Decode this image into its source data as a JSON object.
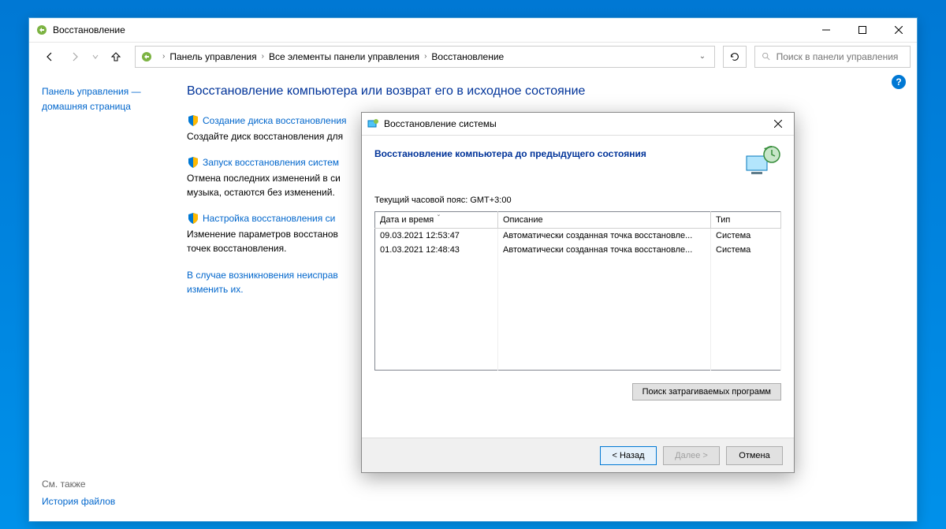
{
  "window": {
    "title": "Восстановление"
  },
  "breadcrumb": {
    "items": [
      "Панель управления",
      "Все элементы панели управления",
      "Восстановление"
    ]
  },
  "search": {
    "placeholder": "Поиск в панели управления"
  },
  "sidebar": {
    "home": "Панель управления — домашняя страница",
    "seeAlsoLabel": "См. также",
    "seeAlsoLink": "История файлов"
  },
  "page": {
    "title": "Восстановление компьютера или возврат его в исходное состояние",
    "items": [
      {
        "link": "Создание диска восстановления",
        "desc": "Создайте диск восстановления для"
      },
      {
        "link": "Запуск восстановления систем",
        "desc": "Отмена последних изменений в си\nмузыка, остаются без изменений."
      },
      {
        "link": "Настройка восстановления си",
        "desc": "Изменение параметров восстанов\nточек восстановления."
      }
    ],
    "error": "В случае возникновения неисправ\nизменить их."
  },
  "dialog": {
    "title": "Восстановление системы",
    "subtitle": "Восстановление компьютера до предыдущего состояния",
    "timezone": "Текущий часовой пояс: GMT+3:00",
    "columns": {
      "dt": "Дата и время",
      "desc": "Описание",
      "type": "Тип"
    },
    "rows": [
      {
        "dt": "09.03.2021 12:53:47",
        "desc": "Автоматически созданная точка восстановле...",
        "type": "Система"
      },
      {
        "dt": "01.03.2021 12:48:43",
        "desc": "Автоматически созданная точка восстановле...",
        "type": "Система"
      }
    ],
    "scanBtn": "Поиск затрагиваемых программ",
    "back": "< Назад",
    "next": "Далее >",
    "cancel": "Отмена"
  }
}
